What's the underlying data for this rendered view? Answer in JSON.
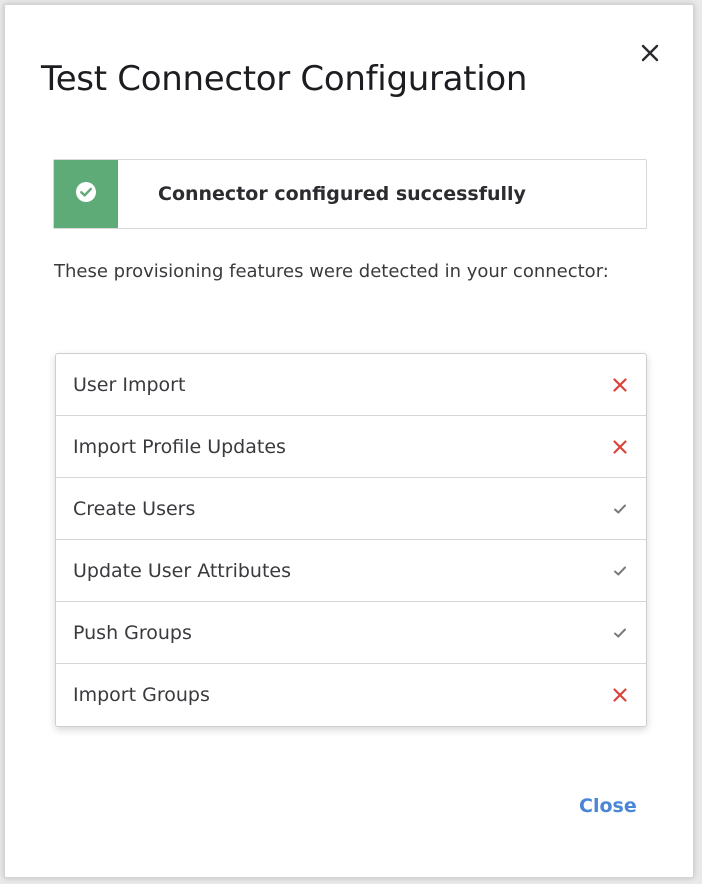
{
  "dialog": {
    "title": "Test Connector Configuration",
    "close_icon": "close-icon"
  },
  "banner": {
    "icon": "check-circle-icon",
    "message": "Connector configured successfully",
    "color": "#5fab78"
  },
  "description": "These provisioning features were detected in your connector:",
  "features": [
    {
      "label": "User Import",
      "status": "unsupported",
      "icon": "cross-icon"
    },
    {
      "label": "Import Profile Updates",
      "status": "unsupported",
      "icon": "cross-icon"
    },
    {
      "label": "Create Users",
      "status": "supported",
      "icon": "check-icon"
    },
    {
      "label": "Update User Attributes",
      "status": "supported",
      "icon": "check-icon"
    },
    {
      "label": "Push Groups",
      "status": "supported",
      "icon": "check-icon"
    },
    {
      "label": "Import Groups",
      "status": "unsupported",
      "icon": "cross-icon"
    }
  ],
  "colors": {
    "unsupported": "#d9443a",
    "supported": "#7a7a7e",
    "link": "#4a86d6"
  },
  "footer": {
    "close_label": "Close"
  }
}
